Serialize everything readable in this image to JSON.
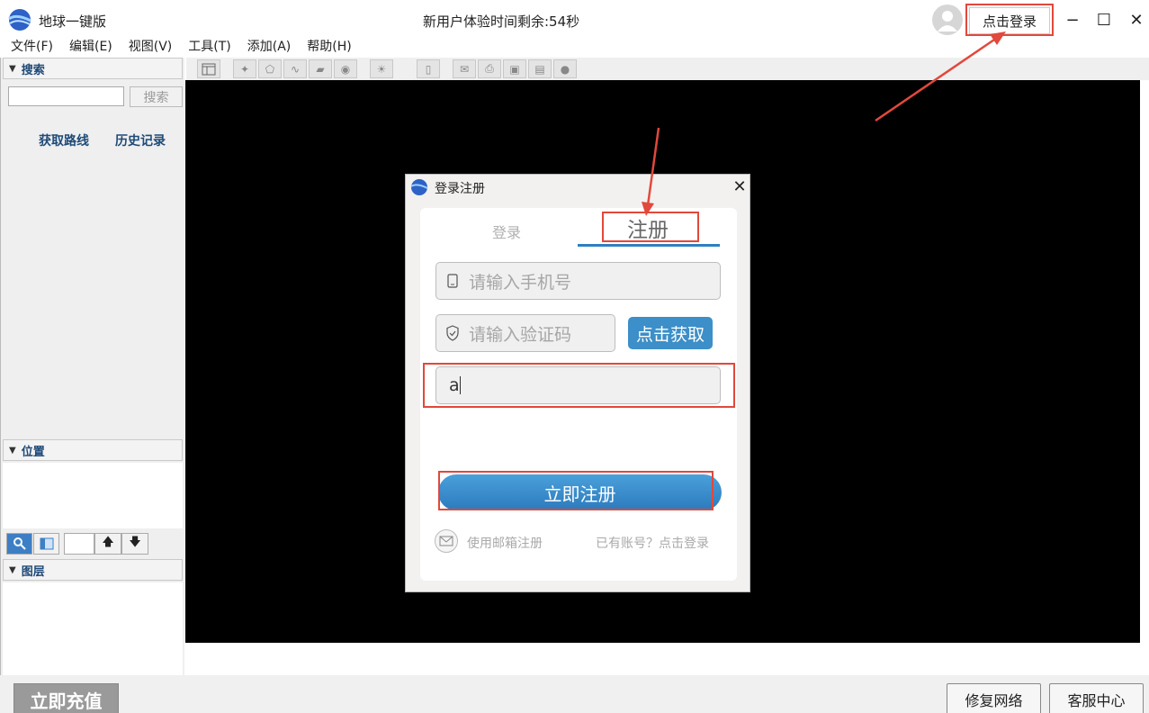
{
  "app": {
    "title": "地球一键版",
    "trial_notice": "新用户体验时间剩余:54秒",
    "login_button": "点击登录",
    "window_controls": {
      "minimize": "−",
      "maximize": "☐",
      "close": "✕"
    }
  },
  "menu": [
    {
      "label": "文件(F)"
    },
    {
      "label": "编辑(E)"
    },
    {
      "label": "视图(V)"
    },
    {
      "label": "工具(T)"
    },
    {
      "label": "添加(A)"
    },
    {
      "label": "帮助(H)"
    }
  ],
  "sidebar": {
    "search_section": "搜索",
    "search_button": "搜索",
    "search_value": "",
    "links": [
      "获取路线",
      "历史记录"
    ],
    "position_section": "位置",
    "layers_section": "图层"
  },
  "bottom": {
    "recharge": "立即充值",
    "repair_network": "修复网络",
    "customer_service": "客服中心"
  },
  "dialog": {
    "title": "登录注册",
    "tabs": {
      "login": "登录",
      "register": "注册"
    },
    "phone_placeholder": "请输入手机号",
    "code_placeholder": "请输入验证码",
    "get_code_button": "点击获取",
    "password_value": "a",
    "register_button": "立即注册",
    "email_register": "使用邮箱注册",
    "has_account": "已有账号？点击登录"
  },
  "colors": {
    "accent": "#3c8fc8",
    "highlight": "#e2483c",
    "section_header_text": "#1f4a78"
  }
}
